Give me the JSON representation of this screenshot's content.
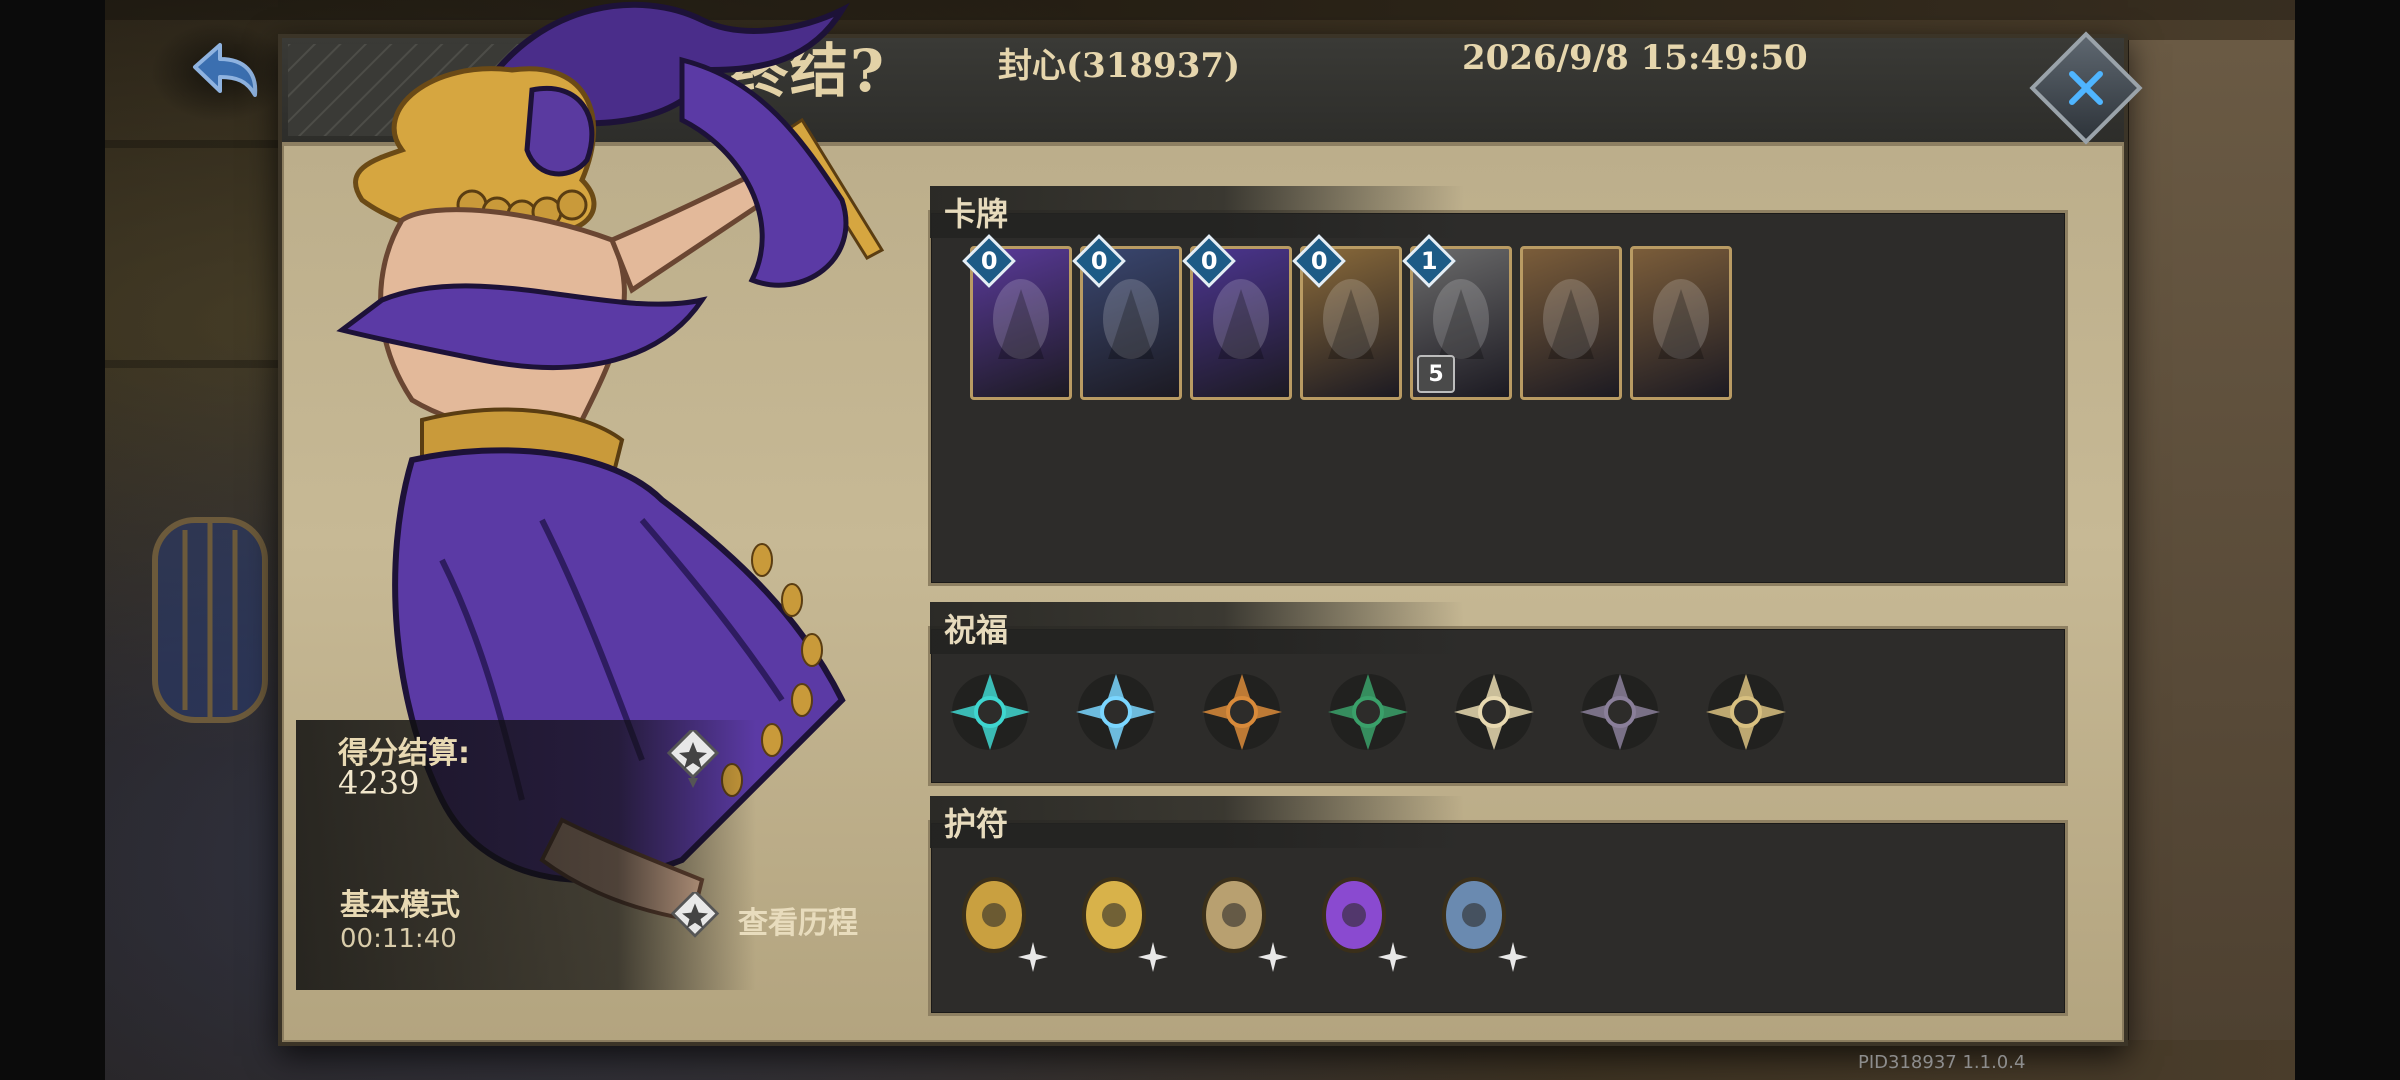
{
  "header": {
    "title": "仪式终结?",
    "player": "封心(318937)",
    "datetime": "2026/9/8 15:49:50"
  },
  "score": {
    "label": "得分结算:",
    "value": "4239"
  },
  "mode": {
    "label": "基本模式",
    "time": "00:11:40"
  },
  "history_button": {
    "label": "查看历程"
  },
  "sections": {
    "cards_title": "卡牌",
    "blessings_title": "祝福",
    "amulets_title": "护符"
  },
  "cards": [
    {
      "name": "card-1",
      "cost": "0",
      "color": "#5a3a9a"
    },
    {
      "name": "card-2",
      "cost": "0",
      "color": "#3a4770"
    },
    {
      "name": "card-3",
      "cost": "0",
      "color": "#4c3590"
    },
    {
      "name": "card-4",
      "cost": "0",
      "color": "#8a6a3a"
    },
    {
      "name": "card-5",
      "cost": "1",
      "color": "#6b6b6b",
      "badge": "5"
    },
    {
      "name": "card-6",
      "cost": "",
      "color": "#7b5d3a"
    },
    {
      "name": "card-7",
      "cost": "",
      "color": "#7b5d3a"
    }
  ],
  "blessings": [
    "teal-rune-icon",
    "shield-burst-icon",
    "crossed-blades-icon",
    "vip-ticket-icon",
    "hourglass-icon",
    "shadow-beast-icon",
    "portrait-medal-icon"
  ],
  "amulets": [
    "golden-slippers-icon",
    "gold-coins-icon",
    "lantern-amulet-icon",
    "potion-bottle-icon",
    "cursed-sigil-icon"
  ],
  "footer": {
    "version": "PID318937  1.1.0.4"
  },
  "colors": {
    "accent_gold": "#e3d2a7",
    "panel_dark": "#2d2c2a",
    "border_tan": "#8e8062",
    "cost_blue": "#1d5b86"
  }
}
